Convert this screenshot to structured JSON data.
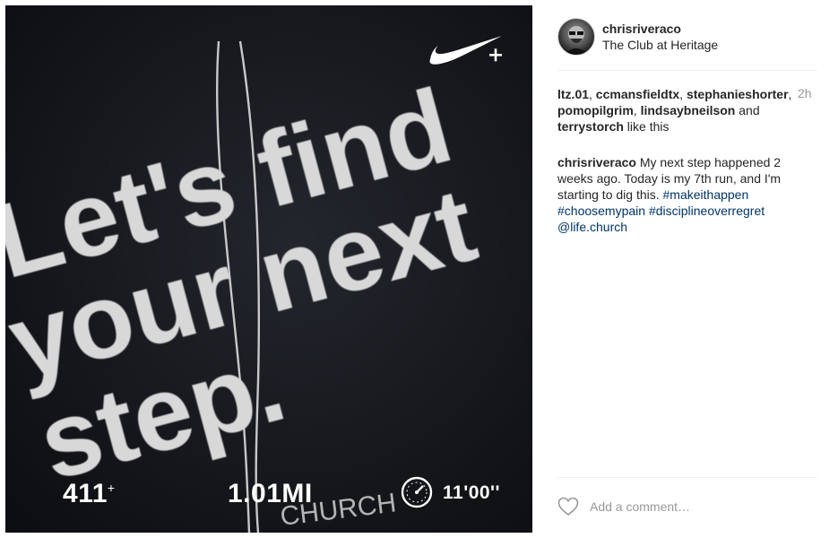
{
  "post": {
    "shirt_lines": [
      "Let's find",
      "your next",
      "step."
    ],
    "shirt_small_text": "CHURCH",
    "stats": {
      "calories": "411",
      "calories_suffix": "+",
      "distance": "1.01MI",
      "pace": "11'00''"
    },
    "icons": {
      "brand": "nike-plus-icon",
      "pace": "stopwatch-icon",
      "like": "heart-icon"
    }
  },
  "header": {
    "username": "chrisriveraco",
    "location": "The Club at Heritage"
  },
  "likes": {
    "users": [
      "ltz.01",
      "ccmansfieldtx",
      "stephanieshorter",
      "pomopilgrim",
      "lindsaybneilson",
      "terrystorch"
    ],
    "separator": ", ",
    "and_text": " and ",
    "suffix": " like this",
    "time_ago": "2h"
  },
  "caption": {
    "username": "chrisriveraco",
    "text": " My next step happened 2 weeks ago. Today is my 7th run, and I'm starting to dig this. ",
    "hashtags": [
      "#makeithappen",
      "#choosemypain",
      "#disciplineoverregret"
    ],
    "mention": "@life.church"
  },
  "comment": {
    "placeholder": "Add a comment…"
  },
  "colors": {
    "link": "#003569",
    "muted": "#999999",
    "text": "#262626"
  }
}
